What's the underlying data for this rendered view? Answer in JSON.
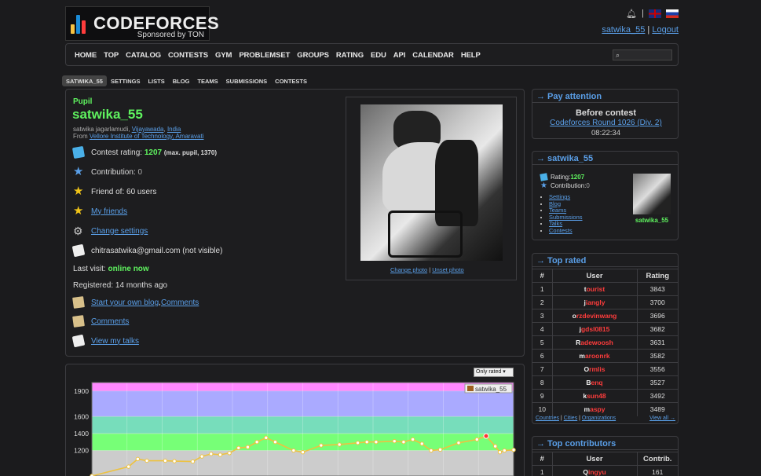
{
  "logo": {
    "brand": "CODEFORCES",
    "sponsor": "Sponsored by TON"
  },
  "header": {
    "username": "satwika_55",
    "logout": "Logout",
    "separator": "|"
  },
  "menu": [
    "HOME",
    "TOP",
    "CATALOG",
    "CONTESTS",
    "GYM",
    "PROBLEMSET",
    "GROUPS",
    "RATING",
    "EDU",
    "API",
    "CALENDAR",
    "HELP"
  ],
  "subtabs": [
    "SATWIKA_55",
    "SETTINGS",
    "LISTS",
    "BLOG",
    "TEAMS",
    "SUBMISSIONS",
    "CONTESTS"
  ],
  "profile": {
    "rank": "Pupil",
    "handle": "satwika_55",
    "name_prefix": "satwika jagarlamudi, ",
    "city": "Vijayawada",
    "comma": ", ",
    "country": "India",
    "from_label": "From ",
    "org": "Vellore Institute of Technology, Amaravati",
    "rating_label": "Contest rating: ",
    "rating": "1207",
    "rating_max": "(max. pupil, 1370)",
    "contribution_label": "Contribution: ",
    "contribution": "0",
    "friend_of": "Friend of: 60 users",
    "my_friends": "My friends",
    "change_settings": "Change settings",
    "email": "chitrasatwika@gmail.com (not visible)",
    "last_visit_label": "Last visit: ",
    "last_visit": "online now",
    "registered": "Registered: 14 months ago",
    "start_blog": "Start your own blog",
    "comma2": ", ",
    "comments_link": "Comments",
    "comments": "Comments",
    "view_talks": "View my talks",
    "change_photo": "Change photo",
    "photo_sep": " | ",
    "unset_photo": "Unset photo"
  },
  "graph": {
    "select": "Only rated"
  },
  "chart_data": {
    "type": "line",
    "series": [
      {
        "name": "satwika_55",
        "values": [
          [
            0,
            900
          ],
          [
            4,
            1010
          ],
          [
            5,
            1100
          ],
          [
            6,
            1080
          ],
          [
            8,
            1080
          ],
          [
            9,
            1075
          ],
          [
            11,
            1070
          ],
          [
            12,
            1130
          ],
          [
            13,
            1160
          ],
          [
            14,
            1150
          ],
          [
            15,
            1170
          ],
          [
            16,
            1230
          ],
          [
            17,
            1240
          ],
          [
            18,
            1300
          ],
          [
            19,
            1350
          ],
          [
            20,
            1300
          ],
          [
            22,
            1200
          ],
          [
            23,
            1180
          ],
          [
            25,
            1260
          ],
          [
            27,
            1270
          ],
          [
            29,
            1290
          ],
          [
            30,
            1300
          ],
          [
            31,
            1300
          ],
          [
            33,
            1310
          ],
          [
            34,
            1300
          ],
          [
            35,
            1330
          ],
          [
            36,
            1280
          ],
          [
            37,
            1200
          ],
          [
            38,
            1210
          ],
          [
            40,
            1290
          ],
          [
            42,
            1330
          ],
          [
            43,
            1370
          ],
          [
            44,
            1250
          ],
          [
            44.5,
            1180
          ],
          [
            45,
            1200
          ],
          [
            46,
            1207
          ]
        ]
      }
    ],
    "yticks": [
      1200,
      1400,
      1600,
      1900
    ],
    "ylim": [
      900,
      2000
    ],
    "grid": true,
    "legend": "top-right"
  },
  "pay_attention": {
    "title": "→ Pay attention",
    "before": "Before contest",
    "contest": "Codeforces Round 1026 (Div. 2)",
    "time": "08:22:34"
  },
  "user_box": {
    "title": "→ satwika_55",
    "rating_label": "Rating: ",
    "rating": "1207",
    "contribution_label": "Contribution: ",
    "contribution": "0",
    "links": [
      "Settings",
      "Blog",
      "Teams",
      "Submissions",
      "Talks",
      "Contests"
    ],
    "name": "satwika_55"
  },
  "top_rated": {
    "title": "→ Top rated",
    "headers": [
      "#",
      "User",
      "Rating"
    ],
    "rows": [
      {
        "n": "1",
        "first": "t",
        "rest": "ourist",
        "r": "3843"
      },
      {
        "n": "2",
        "first": "j",
        "rest": "iangly",
        "r": "3700"
      },
      {
        "n": "3",
        "first": "o",
        "rest": "rzdevinwang",
        "r": "3696"
      },
      {
        "n": "4",
        "first": "j",
        "rest": "gdsl0815",
        "r": "3682"
      },
      {
        "n": "5",
        "first": "R",
        "rest": "adewoosh",
        "r": "3631"
      },
      {
        "n": "6",
        "first": "m",
        "rest": "aroonrk",
        "r": "3582"
      },
      {
        "n": "7",
        "first": "O",
        "rest": "rmlis",
        "r": "3556"
      },
      {
        "n": "8",
        "first": "B",
        "rest": "enq",
        "r": "3527"
      },
      {
        "n": "9",
        "first": "k",
        "rest": "sun48",
        "r": "3492"
      },
      {
        "n": "10",
        "first": "m",
        "rest": "aspy",
        "r": "3489"
      }
    ],
    "footer_links": [
      "Countries",
      "Cities",
      "Organizations"
    ],
    "footer_sep": " | ",
    "view_all": "View all →"
  },
  "top_contrib": {
    "title": "→ Top contributors",
    "headers": [
      "#",
      "User",
      "Contrib."
    ],
    "rows": [
      {
        "n": "1",
        "first": "Q",
        "rest": "ingyu",
        "r": "161"
      }
    ]
  }
}
